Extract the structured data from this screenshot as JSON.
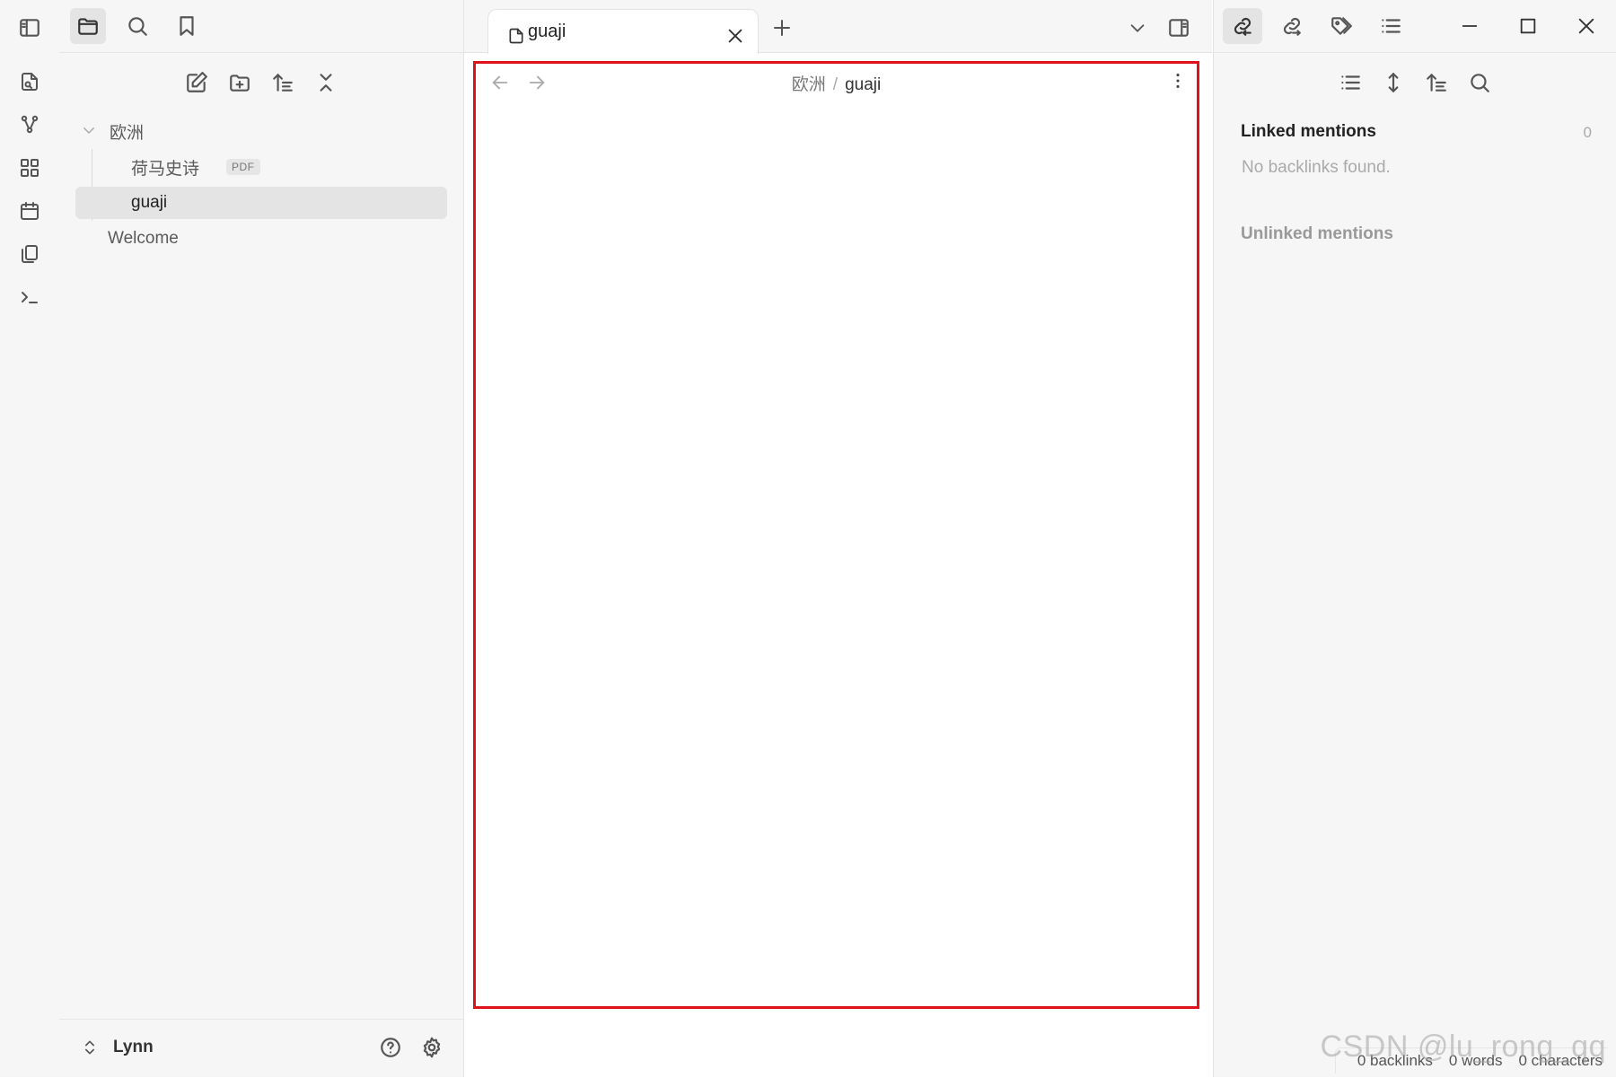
{
  "left_sidebar": {
    "tree": [
      {
        "label": "欧洲",
        "type": "folder",
        "expanded": true
      },
      {
        "label": "荷马史诗",
        "badge": "PDF",
        "type": "file"
      },
      {
        "label": "guaji",
        "type": "file",
        "active": true
      },
      {
        "label": "Welcome",
        "type": "file"
      }
    ],
    "vault_name": "Lynn"
  },
  "tabs": [
    {
      "title": "guaji",
      "active": true
    }
  ],
  "view": {
    "breadcrumb_parent": "欧洲",
    "breadcrumb_separator": "/",
    "breadcrumb_current": "guaji"
  },
  "backlinks": {
    "linked_title": "Linked mentions",
    "linked_count": "0",
    "empty_text": "No backlinks found.",
    "unlinked_title": "Unlinked mentions"
  },
  "status_bar": {
    "backlinks": "0 backlinks",
    "words": "0 words",
    "characters": "0 characters"
  },
  "watermark": "CSDN @lu_rong_qq",
  "colors": {
    "highlight_border": "#e0101c",
    "sidebar_bg": "#f6f6f6",
    "active_item": "#e4e4e4"
  },
  "icons": [
    "sidebar-toggle",
    "folder",
    "search",
    "bookmark",
    "new-note",
    "new-folder",
    "sort",
    "collapse",
    "chevron-down",
    "file",
    "close",
    "plus",
    "split-right",
    "link",
    "outgoing-link",
    "tags",
    "outline",
    "minimize",
    "maximize",
    "arrow-left",
    "arrow-right",
    "more-vertical",
    "list",
    "expand",
    "help",
    "gear"
  ]
}
